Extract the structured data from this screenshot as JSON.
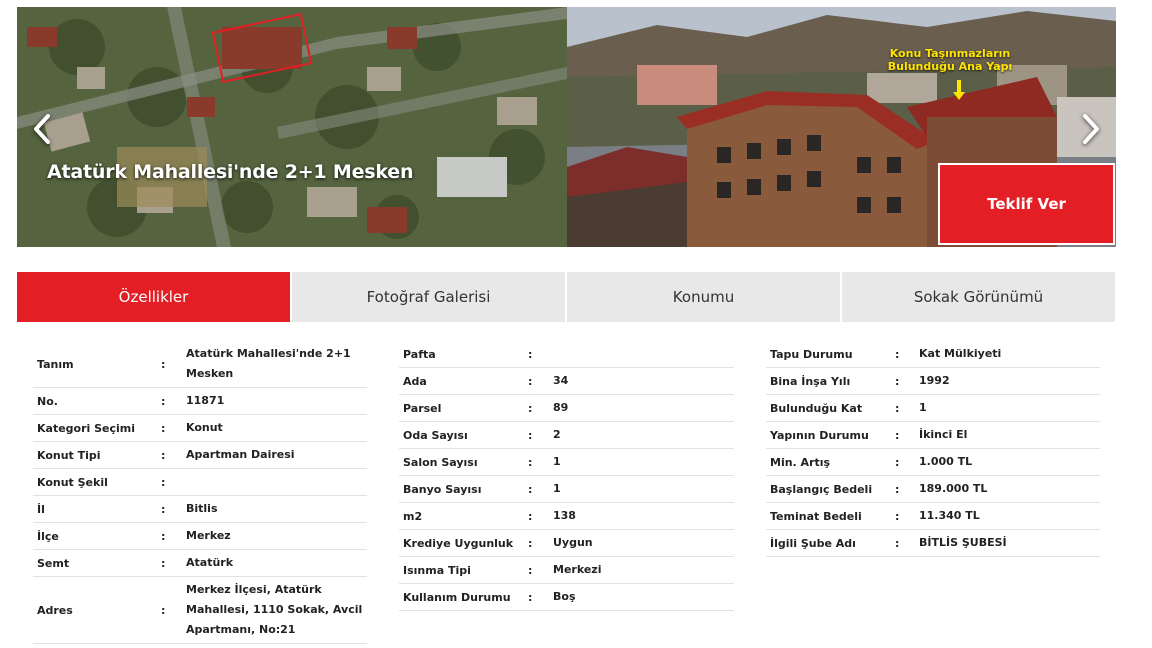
{
  "hero": {
    "title": "Atatürk Mahallesi'nde 2+1 Mesken",
    "annotation": "Konu Taşınmazların Bulunduğu Ana Yapı",
    "offer_button": "Teklif Ver",
    "prev_icon": "chevron-left-icon",
    "next_icon": "chevron-right-icon"
  },
  "tabs": [
    {
      "label": "Özellikler",
      "active": true
    },
    {
      "label": "Fotoğraf Galerisi",
      "active": false
    },
    {
      "label": "Konumu",
      "active": false
    },
    {
      "label": "Sokak Görünümü",
      "active": false
    }
  ],
  "details": {
    "col1": [
      {
        "label": "Tanım",
        "value": "Atatürk Mahallesi'nde 2+1 Mesken"
      },
      {
        "label": "No.",
        "value": "11871"
      },
      {
        "label": "Kategori Seçimi",
        "value": "Konut"
      },
      {
        "label": "Konut Tipi",
        "value": "Apartman Dairesi"
      },
      {
        "label": "Konut Şekil",
        "value": ""
      },
      {
        "label": "İl",
        "value": "Bitlis"
      },
      {
        "label": "İlçe",
        "value": "Merkez"
      },
      {
        "label": "Semt",
        "value": "Atatürk"
      },
      {
        "label": "Adres",
        "value": "Merkez İlçesi, Atatürk Mahallesi, 1110 Sokak, Avcil Apartmanı, No:21"
      }
    ],
    "col2": [
      {
        "label": "Pafta",
        "value": ""
      },
      {
        "label": "Ada",
        "value": "34"
      },
      {
        "label": "Parsel",
        "value": "89"
      },
      {
        "label": "Oda Sayısı",
        "value": "2"
      },
      {
        "label": "Salon Sayısı",
        "value": "1"
      },
      {
        "label": "Banyo Sayısı",
        "value": "1"
      },
      {
        "label": "m2",
        "value": "138"
      },
      {
        "label": "Krediye Uygunluk",
        "value": "Uygun"
      },
      {
        "label": "Isınma Tipi",
        "value": "Merkezi"
      },
      {
        "label": "Kullanım Durumu",
        "value": "Boş"
      }
    ],
    "col3": [
      {
        "label": "Tapu Durumu",
        "value": "Kat Mülkiyeti"
      },
      {
        "label": "Bina İnşa Yılı",
        "value": "1992"
      },
      {
        "label": "Bulunduğu Kat",
        "value": "1"
      },
      {
        "label": "Yapının Durumu",
        "value": "İkinci El"
      },
      {
        "label": "Min. Artış",
        "value": "1.000 TL"
      },
      {
        "label": "Başlangıç Bedeli",
        "value": "189.000 TL"
      },
      {
        "label": "Teminat Bedeli",
        "value": "11.340 TL"
      },
      {
        "label": "İlgili Şube Adı",
        "value": "BİTLİS ŞUBESİ"
      }
    ],
    "separator": ":"
  },
  "colors": {
    "accent": "#e31e24",
    "tab_inactive": "#e8e8e8",
    "annotation": "#ffe600"
  }
}
